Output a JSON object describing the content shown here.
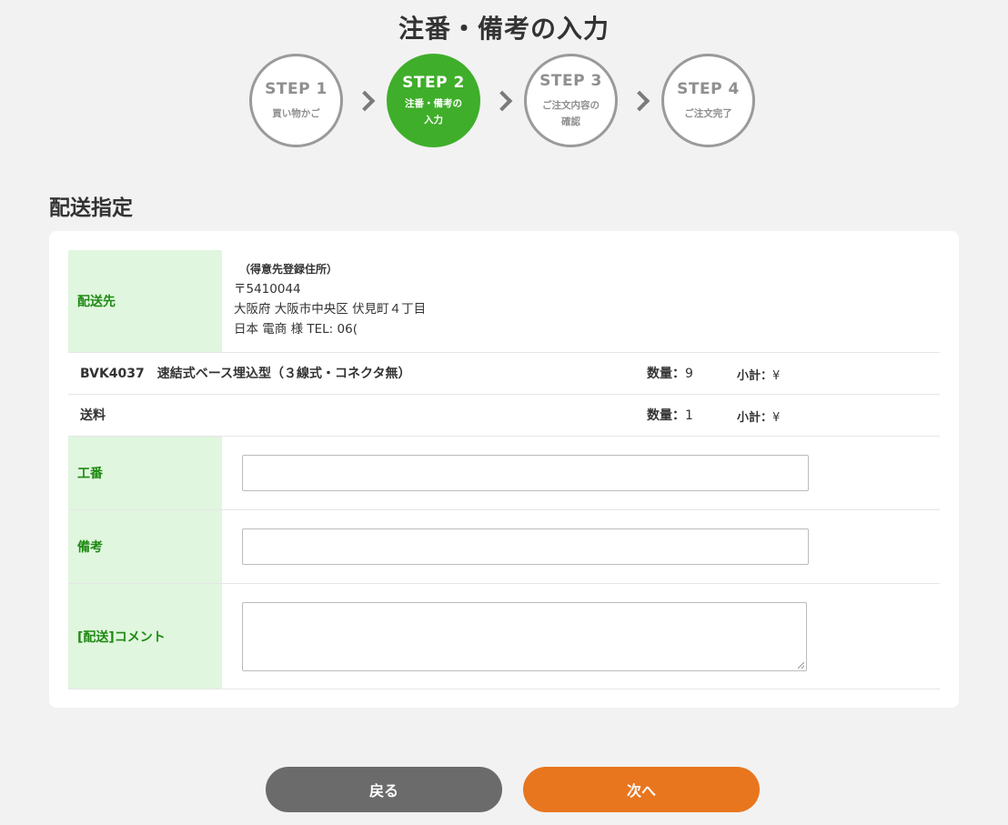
{
  "page_title": "注番・備考の入力",
  "steps": [
    {
      "num": "STEP 1",
      "label": "買い物かご"
    },
    {
      "num": "STEP 2",
      "label": "注番・備考の\n入力"
    },
    {
      "num": "STEP 3",
      "label": "ご注文内容の\n確認"
    },
    {
      "num": "STEP 4",
      "label": "ご注文完了"
    }
  ],
  "active_step": 2,
  "colors": {
    "accent_green": "#3fae2a",
    "label_bg": "#e0f6de",
    "label_text": "#1f8a14",
    "next_button": "#e8761f",
    "back_button": "#6b6b6b"
  },
  "section_title": "配送指定",
  "shipping": {
    "label": "配送先",
    "source": "（得意先登録住所）",
    "postal": "〒5410044",
    "address": "大阪府 大阪市中央区 伏見町４丁目",
    "name_tel": "日本 電商 様 TEL: 06("
  },
  "items": [
    {
      "name": "BVK4037　速結式ベース埋込型（３線式・コネクタ無）",
      "qty_label": "数量：",
      "qty": "9",
      "subtotal_label": "小計：",
      "subtotal": "¥"
    },
    {
      "name": "送料",
      "qty_label": "数量：",
      "qty": "1",
      "subtotal_label": "小計：",
      "subtotal": "¥"
    }
  ],
  "fields": {
    "koban": {
      "label": "工番",
      "value": ""
    },
    "biko": {
      "label": "備考",
      "value": ""
    },
    "comment": {
      "label": "[配送]コメント",
      "value": ""
    }
  },
  "buttons": {
    "back": "戻る",
    "next": "次へ"
  }
}
